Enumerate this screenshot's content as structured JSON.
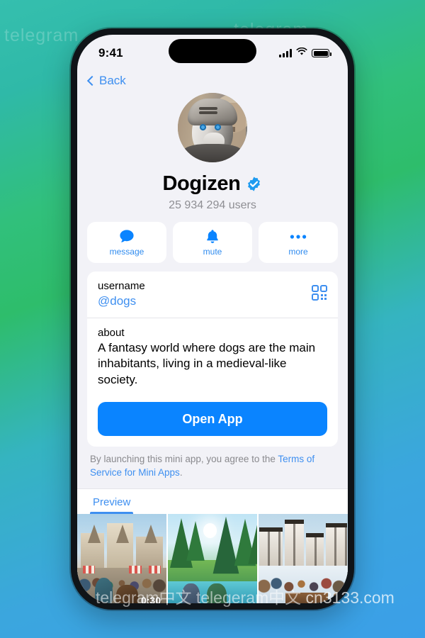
{
  "watermarks": {
    "top_left": "telegram",
    "top_right": "telegram",
    "bottom": "telegram中文 telegeram中文 ",
    "bottom_domain": "cn3133.com"
  },
  "status_bar": {
    "time": "9:41",
    "signal_icon": "signal-bars-icon",
    "wifi_icon": "wifi-icon",
    "battery_icon": "battery-icon"
  },
  "nav": {
    "back_label": "Back",
    "back_icon": "chevron-left-icon"
  },
  "profile": {
    "avatar_icon": "knight-husky-avatar",
    "name": "Dogizen",
    "verified_icon": "verified-badge-icon",
    "subtitle": "25 934 294 users"
  },
  "actions": [
    {
      "label": "message",
      "icon": "chat-bubble-icon"
    },
    {
      "label": "mute",
      "icon": "bell-icon"
    },
    {
      "label": "more",
      "icon": "ellipsis-icon"
    }
  ],
  "info_card": {
    "username_label": "username",
    "username_value": "@dogs",
    "qr_icon": "qr-code-icon",
    "about_label": "about",
    "about_text": "A fantasy world where dogs are the main inhabitants, living in a medieval-like society.",
    "open_app_label": "Open App"
  },
  "disclaimer": {
    "text": "By launching this mini app, you agree to the ",
    "link": "Terms of Service for Mini Apps",
    "period": "."
  },
  "tabs": [
    {
      "label": "Preview",
      "active": true
    }
  ],
  "gallery": {
    "items": [
      {
        "name": "medieval-town-square",
        "duration": "0:30"
      },
      {
        "name": "forest-lake-scene",
        "duration": ""
      },
      {
        "name": "snowy-village-market",
        "duration": ""
      }
    ]
  },
  "colors": {
    "accent_blue": "#3E8FF0",
    "button_blue": "#0A84FF",
    "verified_blue": "#1D9BF0",
    "page_bg": "#F2F2F7",
    "card_bg": "#FFFFFF",
    "muted_text": "#8E8E93"
  }
}
